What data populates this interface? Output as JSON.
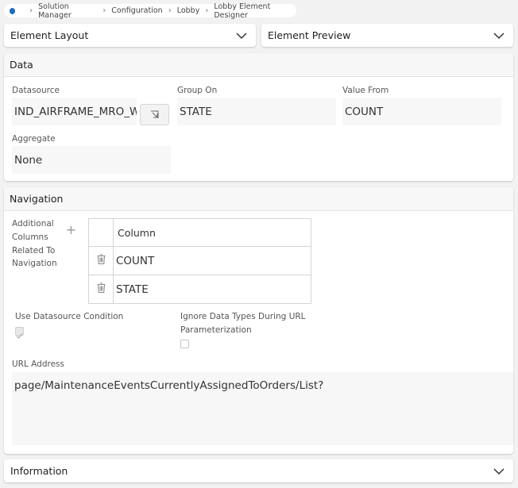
{
  "breadcrumb": [
    "Solution Manager",
    "Configuration",
    "Lobby",
    "Lobby Element Designer"
  ],
  "element_layout": {
    "label": "Element Layout"
  },
  "element_preview": {
    "label": "Element Preview"
  },
  "data_section": {
    "title": "Data",
    "datasource": {
      "label": "Datasource",
      "value": "IND_AIRFRAME_MRO_W"
    },
    "group_on": {
      "label": "Group On",
      "value": "STATE"
    },
    "value_from": {
      "label": "Value From",
      "value": "COUNT"
    },
    "aggregate": {
      "label": "Aggregate",
      "value": "None"
    }
  },
  "navigation_section": {
    "title": "Navigation",
    "additional_columns_label": [
      "Additional",
      "Columns",
      "Related To",
      "Navigation"
    ],
    "add_symbol": "+",
    "table": {
      "header": "Column",
      "rows": [
        "COUNT",
        "STATE"
      ]
    },
    "use_datasource_condition": {
      "label": "Use Datasource Condition",
      "checked": true
    },
    "ignore_data_types": {
      "label_line1": "Ignore Data Types During URL",
      "label_line2": "Parameterization",
      "checked": false
    },
    "url_address": {
      "label": "URL Address",
      "value": "page/MaintenanceEventsCurrentlyAssignedToOrders/List?"
    }
  },
  "information": {
    "label": "Information"
  }
}
